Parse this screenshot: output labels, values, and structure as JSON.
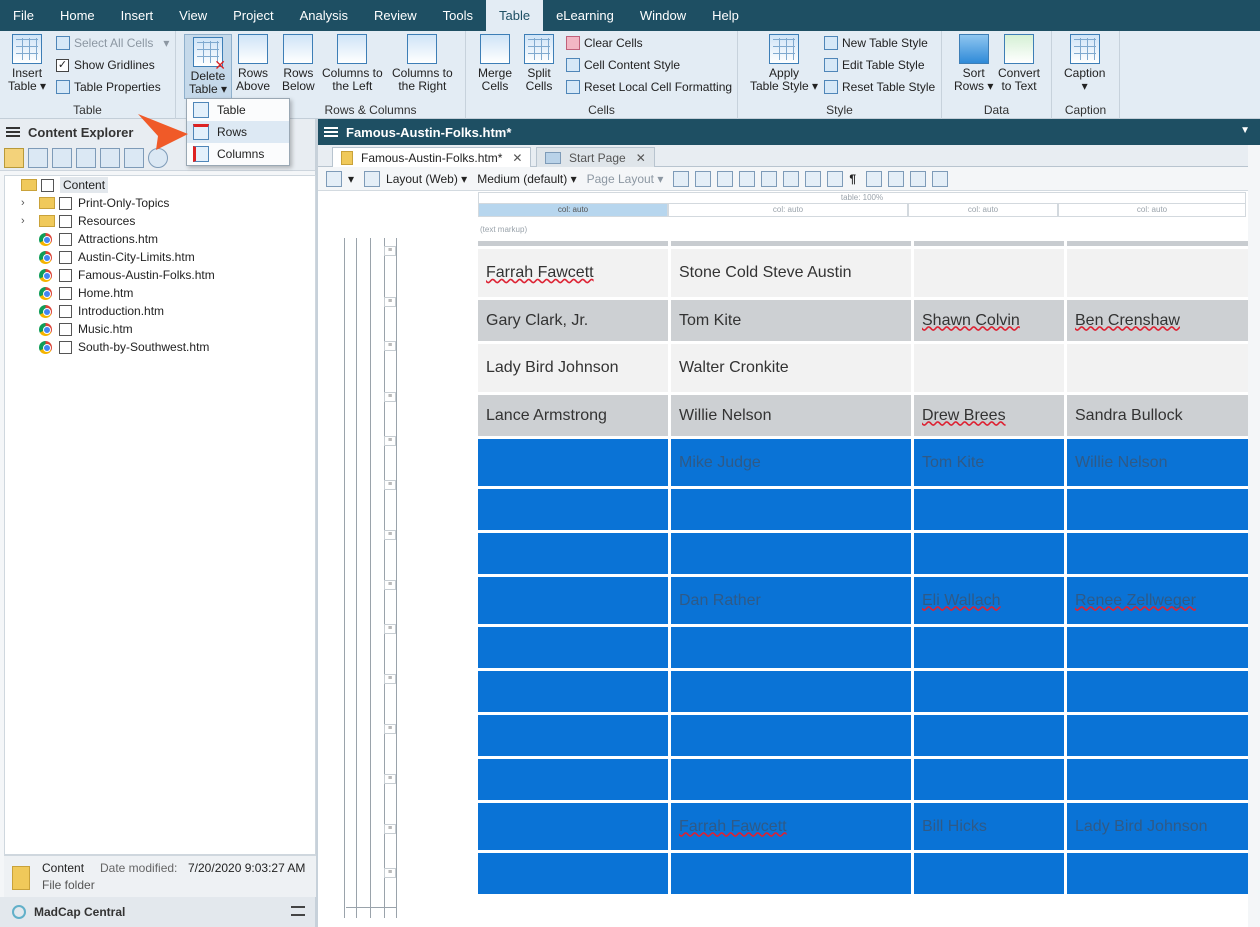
{
  "menu": [
    "File",
    "Home",
    "Insert",
    "View",
    "Project",
    "Analysis",
    "Review",
    "Tools",
    "Table",
    "eLearning",
    "Window",
    "Help"
  ],
  "menu_active": "Table",
  "ribbon": {
    "groups": {
      "table": "Table",
      "rows_columns": "Rows & Columns",
      "cells": "Cells",
      "style": "Style",
      "data": "Data",
      "caption": "Caption"
    },
    "insert_table": [
      "Insert",
      "Table"
    ],
    "select_all_cells": "Select All Cells",
    "show_gridlines": "Show Gridlines",
    "table_properties": "Table Properties",
    "delete_table": [
      "Delete",
      "Table"
    ],
    "rows_above": [
      "Rows",
      "Above"
    ],
    "rows_below": [
      "Rows",
      "Below"
    ],
    "columns_left": [
      "Columns to",
      "the Left"
    ],
    "columns_right": [
      "Columns to",
      "the Right"
    ],
    "merge_cells": [
      "Merge",
      "Cells"
    ],
    "split_cells": [
      "Split",
      "Cells"
    ],
    "clear_cells": "Clear Cells",
    "cell_content_style": "Cell Content Style",
    "reset_local": "Reset Local Cell Formatting",
    "apply_table_style": [
      "Apply",
      "Table Style"
    ],
    "new_table_style": "New Table Style",
    "edit_table_style": "Edit Table Style",
    "reset_table_style": "Reset Table Style",
    "sort_rows": [
      "Sort",
      "Rows"
    ],
    "convert_to_text": [
      "Convert",
      "to Text"
    ],
    "caption": "Caption"
  },
  "dropdown": [
    "Table",
    "Rows",
    "Columns"
  ],
  "content_explorer": {
    "title": "Content Explorer",
    "root": "Content",
    "items": [
      {
        "name": "Print-Only-Topics",
        "type": "folder"
      },
      {
        "name": "Resources",
        "type": "folder"
      },
      {
        "name": "Attractions.htm",
        "type": "file"
      },
      {
        "name": "Austin-City-Limits.htm",
        "type": "file"
      },
      {
        "name": "Famous-Austin-Folks.htm",
        "type": "file"
      },
      {
        "name": "Home.htm",
        "type": "file"
      },
      {
        "name": "Introduction.htm",
        "type": "file"
      },
      {
        "name": "Music.htm",
        "type": "file"
      },
      {
        "name": "South-by-Southwest.htm",
        "type": "file"
      }
    ],
    "status": {
      "name": "Content",
      "type": "File folder",
      "date_label": "Date modified:",
      "date": "7/20/2020 9:03:27 AM"
    },
    "footer": "MadCap Central"
  },
  "editor": {
    "title": "Famous-Austin-Folks.htm*",
    "tabs": [
      "Famous-Austin-Folks.htm*",
      "Start Page"
    ],
    "toolbar": {
      "layout": "Layout (Web)",
      "medium": "Medium (default)",
      "page_layout": "Page Layout"
    },
    "table_label": "table: 100%",
    "col_labels": [
      "col: auto",
      "col: auto",
      "col: auto",
      "col: auto"
    ],
    "markup": "(text markup)"
  },
  "table_rows": [
    {
      "style": "lt",
      "cells": [
        "Farrah Fawcett",
        "Stone Cold Steve Austin",
        "",
        ""
      ]
    },
    {
      "style": "dk",
      "cells": [
        "Gary Clark, Jr.",
        "Tom Kite",
        "Shawn Colvin",
        "Ben Crenshaw"
      ]
    },
    {
      "style": "lt",
      "cells": [
        "Lady Bird Johnson",
        "Walter Cronkite",
        "",
        ""
      ]
    },
    {
      "style": "dk",
      "cells": [
        "Lance Armstrong",
        "Willie Nelson",
        "Drew Brees",
        "Sandra Bullock"
      ]
    },
    {
      "style": "sel",
      "cells": [
        "",
        "Mike Judge",
        "Tom Kite",
        "Willie Nelson"
      ]
    },
    {
      "style": "sel",
      "cells": [
        "",
        "",
        "",
        ""
      ]
    },
    {
      "style": "sel",
      "cells": [
        "",
        "",
        "",
        ""
      ]
    },
    {
      "style": "sel",
      "cells": [
        "",
        "Dan Rather",
        "Eli Wallach",
        "Renee Zellweger"
      ]
    },
    {
      "style": "sel",
      "cells": [
        "",
        "",
        "",
        ""
      ]
    },
    {
      "style": "sel",
      "cells": [
        "",
        "",
        "",
        ""
      ]
    },
    {
      "style": "sel",
      "cells": [
        "",
        "",
        "",
        ""
      ]
    },
    {
      "style": "sel",
      "cells": [
        "",
        "",
        "",
        ""
      ]
    },
    {
      "style": "sel",
      "cells": [
        "",
        "Farrah Fawcett",
        "Bill Hicks",
        "Lady Bird Johnson"
      ]
    },
    {
      "style": "sel",
      "cells": [
        "",
        "",
        "",
        ""
      ]
    }
  ],
  "colors": {
    "accent": "#1e4f63",
    "selection": "#0a73d6",
    "callout": "#f05a28"
  }
}
